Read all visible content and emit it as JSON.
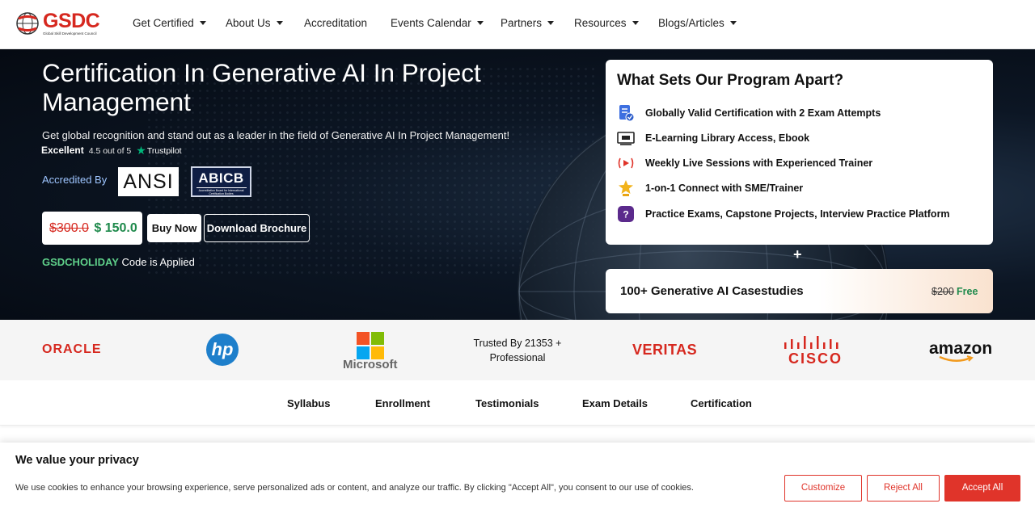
{
  "brand": {
    "logo_text": "GSDC",
    "logo_subtitle": "Global Skill Development Council"
  },
  "nav": {
    "items": [
      {
        "label": "Get Certified",
        "dropdown": true
      },
      {
        "label": "About Us",
        "dropdown": true
      },
      {
        "label": "Accreditation",
        "dropdown": false
      },
      {
        "label": "Events Calendar",
        "dropdown": true
      },
      {
        "label": "Partners",
        "dropdown": true
      },
      {
        "label": "Resources",
        "dropdown": true
      },
      {
        "label": "Blogs/Articles",
        "dropdown": true
      }
    ]
  },
  "hero": {
    "title": "Certification In Generative AI In Project Management",
    "subtitle": "Get global recognition and stand out as a leader in the field of Generative AI In Project Management!",
    "rating_label": "Excellent",
    "rating_score": "4.5 out of 5",
    "rating_source": "Trustpilot",
    "accredited_label": "Accredited By",
    "ansi_label": "ANSI",
    "abicb_label": "ABICB",
    "abicb_sub": "Accreditation Board for International Certification Bodies",
    "old_price": "$300.0",
    "new_price": "$ 150.0",
    "buy_label": "Buy Now",
    "brochure_label": "Download Brochure",
    "coupon_code": "GSDCHOLIDAY",
    "coupon_suffix": "Code is Applied"
  },
  "program": {
    "title": "What Sets Our Program Apart?",
    "features": [
      {
        "icon": "certificate-icon",
        "label": "Globally Valid Certification with 2 Exam Attempts"
      },
      {
        "icon": "elearning-icon",
        "label": "E-Learning Library Access, Ebook"
      },
      {
        "icon": "live-broadcast-icon",
        "label": "Weekly Live Sessions with Experienced Trainer"
      },
      {
        "icon": "star-trophy-icon",
        "label": "1-on-1 Connect with SME/Trainer"
      },
      {
        "icon": "question-icon",
        "label": "Practice Exams, Capstone Projects, Interview Practice Platform"
      }
    ],
    "plus": "+",
    "casestudies_label": "100+ Generative AI Casestudies",
    "casestudies_old_price": "$200",
    "casestudies_free": "Free"
  },
  "logos": {
    "oracle": "ORACLE",
    "hp": "hp",
    "microsoft": "Microsoft",
    "trusted_line1": "Trusted By 21353 +",
    "trusted_line2": "Professional",
    "veritas": "VERITAS",
    "cisco": "CISCO",
    "amazon": "amazon"
  },
  "subnav": {
    "items": [
      "Syllabus",
      "Enrollment",
      "Testimonials",
      "Exam Details",
      "Certification"
    ]
  },
  "cookie": {
    "title": "We value your privacy",
    "text": "We use cookies to enhance your browsing experience, serve personalized ads or content, and analyze our traffic. By clicking \"Accept All\", you consent to our use of cookies.",
    "customize": "Customize",
    "reject": "Reject All",
    "accept": "Accept All"
  },
  "colors": {
    "brand_red": "#d6281f",
    "accent_green": "#1f8a4c",
    "coupon_green": "#5fd08a",
    "accredited_blue": "#9ec5ff",
    "cookie_red": "#e0342a"
  }
}
